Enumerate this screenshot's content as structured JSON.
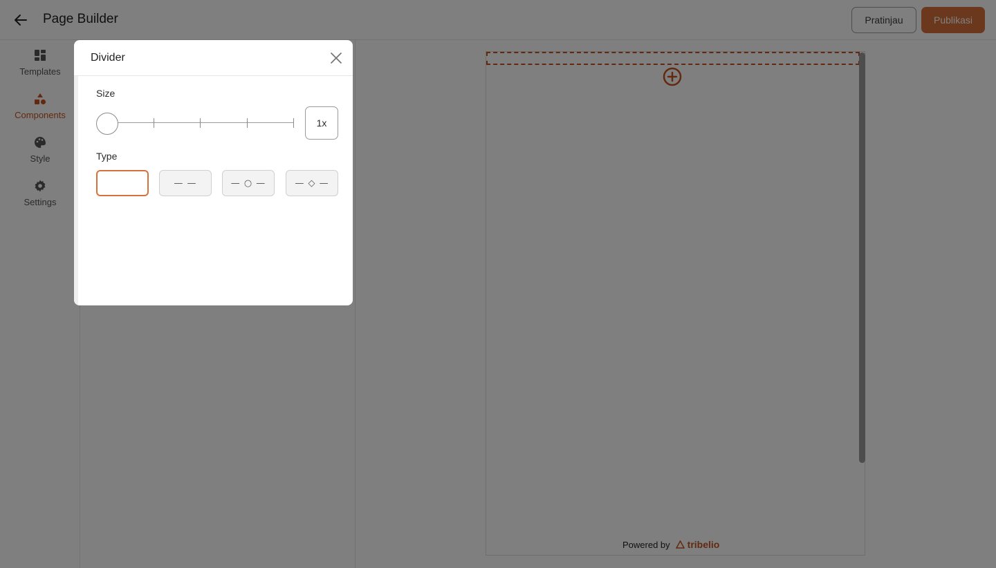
{
  "header": {
    "title": "Page Builder",
    "preview_label": "Pratinjau",
    "publish_label": "Publikasi",
    "accent_color": "#d8703a"
  },
  "sidebar": {
    "items": [
      {
        "label": "Templates",
        "icon": "dashboard-icon",
        "active": false
      },
      {
        "label": "Components",
        "icon": "shapes-icon",
        "active": true
      },
      {
        "label": "Style",
        "icon": "palette-icon",
        "active": false
      },
      {
        "label": "Settings",
        "icon": "gear-icon",
        "active": false
      }
    ]
  },
  "canvas": {
    "powered_by": "Powered by",
    "brand": "tribelio"
  },
  "modal": {
    "title": "Divider",
    "size_label": "Size",
    "size_value": "1x",
    "size_level": 0,
    "type_label": "Type",
    "types": [
      {
        "display": "",
        "selected": true
      },
      {
        "display": "— —",
        "selected": false
      },
      {
        "display": "— ○ —",
        "selected": false
      },
      {
        "display": "— ◇ —",
        "selected": false
      }
    ]
  }
}
